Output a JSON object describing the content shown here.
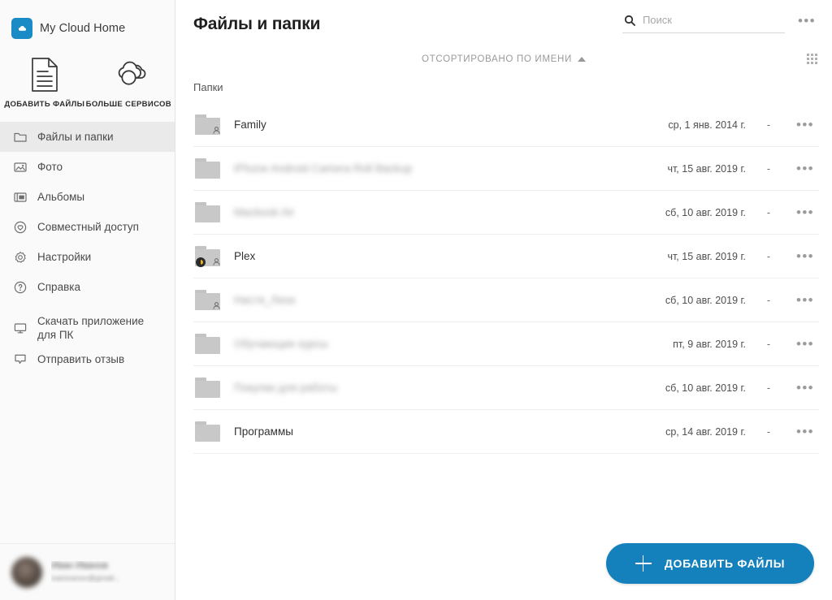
{
  "brand": {
    "name": "My Cloud Home",
    "logo_icon": "cloud-home-logo-icon",
    "accent_color": "#1a8bc4"
  },
  "quick_actions": [
    {
      "label": "ДОБАВИТЬ ФАЙЛЫ",
      "icon": "document-lines-icon"
    },
    {
      "label": "БОЛЬШЕ СЕРВИСОВ",
      "icon": "clouds-icon"
    }
  ],
  "sidebar": {
    "items": [
      {
        "label": "Файлы и папки",
        "icon": "folder-icon",
        "active": true
      },
      {
        "label": "Фото",
        "icon": "photo-icon",
        "active": false
      },
      {
        "label": "Альбомы",
        "icon": "album-icon",
        "active": false
      },
      {
        "label": "Совместный доступ",
        "icon": "heart-circle-icon",
        "active": false
      },
      {
        "label": "Настройки",
        "icon": "gear-icon",
        "active": false
      },
      {
        "label": "Справка",
        "icon": "question-circle-icon",
        "active": false
      },
      {
        "label": "Скачать приложение для ПК",
        "icon": "monitor-icon",
        "active": false
      },
      {
        "label": "Отправить отзыв",
        "icon": "speech-bubble-icon",
        "active": false
      }
    ]
  },
  "profile": {
    "name": "Иван Иванов",
    "email": "ivanivanov@gmail...",
    "avatar_icon": "avatar"
  },
  "header": {
    "title": "Файлы и папки",
    "search": {
      "placeholder": "Поиск",
      "value": "",
      "icon": "search-icon"
    },
    "overflow_icon": "kebab-menu-icon",
    "overflow_label": "•••"
  },
  "toolbar": {
    "sort_label": "ОТСОРТИРОВАНО ПО ИМЕНИ",
    "sort_direction": "ascending",
    "grid_view_icon": "grid-view-icon"
  },
  "main": {
    "section_label": "Папки",
    "rows": [
      {
        "name": "Family",
        "redacted": false,
        "date": "ср, 1 янв. 2014 г.",
        "size": "-",
        "icon": "folder-shared-icon",
        "badges": [
          "person"
        ]
      },
      {
        "name": "iPhone Android Camera Roll Backup",
        "redacted": true,
        "date": "чт, 15 авг. 2019 г.",
        "size": "-",
        "icon": "folder-icon",
        "badges": []
      },
      {
        "name": "Macbook Air",
        "redacted": true,
        "date": "сб, 10 авг. 2019 г.",
        "size": "-",
        "icon": "folder-icon",
        "badges": []
      },
      {
        "name": "Plex",
        "redacted": false,
        "date": "чт, 15 авг. 2019 г.",
        "size": "-",
        "icon": "folder-shared-media-icon",
        "badges": [
          "coin",
          "person"
        ]
      },
      {
        "name": "Настя_Лиза",
        "redacted": true,
        "date": "сб, 10 авг. 2019 г.",
        "size": "-",
        "icon": "folder-shared-icon",
        "badges": [
          "person"
        ]
      },
      {
        "name": "Обучающие курсы",
        "redacted": true,
        "date": "пт, 9 авг. 2019 г.",
        "size": "-",
        "icon": "folder-icon",
        "badges": []
      },
      {
        "name": "Покупки для работы",
        "redacted": true,
        "date": "сб, 10 авг. 2019 г.",
        "size": "-",
        "icon": "folder-icon",
        "badges": []
      },
      {
        "name": "Программы",
        "redacted": false,
        "date": "ср, 14 авг. 2019 г.",
        "size": "-",
        "icon": "folder-icon",
        "badges": []
      }
    ],
    "row_menu_label": "•••"
  },
  "fab": {
    "label": "ДОБАВИТЬ ФАЙЛЫ",
    "icon": "plus-icon",
    "color": "#1481bd"
  }
}
